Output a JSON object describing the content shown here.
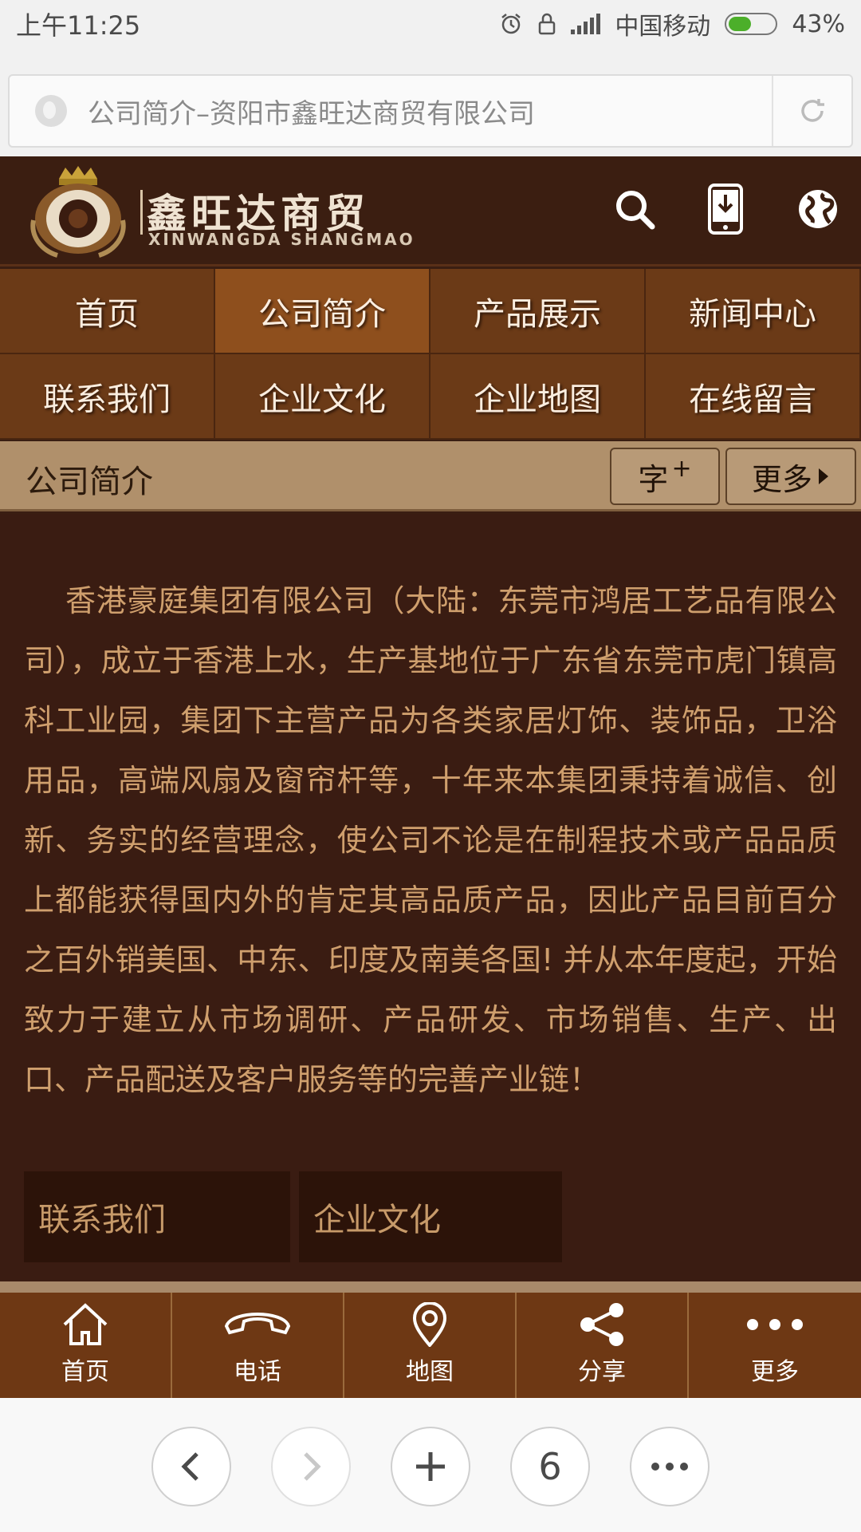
{
  "status": {
    "time": "上午11:25",
    "carrier": "中国移动",
    "battery": "43%"
  },
  "address_bar": {
    "title": "公司简介–资阳市鑫旺达商贸有限公司"
  },
  "site": {
    "logo_cn": "鑫旺达商贸",
    "logo_en": "XINWANGDA SHANGMAO"
  },
  "nav": [
    {
      "label": "首页"
    },
    {
      "label": "公司简介"
    },
    {
      "label": "产品展示"
    },
    {
      "label": "新闻中心"
    },
    {
      "label": "联系我们"
    },
    {
      "label": "企业文化"
    },
    {
      "label": "企业地图"
    },
    {
      "label": "在线留言"
    }
  ],
  "section": {
    "title": "公司简介",
    "font_button": "字",
    "font_button_plus": "+",
    "more_button": "更多"
  },
  "article": {
    "body": "香港豪庭集团有限公司（大陆：东莞市鸿居工艺品有限公司），成立于香港上水，生产基地位于广东省东莞市虎门镇高科工业园，集团下主营产品为各类家居灯饰、装饰品，卫浴用品，高端风扇及窗帘杆等，十年来本集团秉持着诚信、创新、务实的经营理念，使公司不论是在制程技术或产品品质上都能获得国内外的肯定其高品质产品，因此产品目前百分之百外销美国、中东、印度及南美各国! 并从本年度起，开始致力于建立从市场调研、产品研发、市场销售、生产、出口、产品配送及客户服务等的完善产业链！"
  },
  "related": [
    {
      "label": "联系我们"
    },
    {
      "label": "企业文化"
    }
  ],
  "toolbar": [
    {
      "label": "首页",
      "icon": "home-icon"
    },
    {
      "label": "电话",
      "icon": "phone-icon"
    },
    {
      "label": "地图",
      "icon": "map-pin-icon"
    },
    {
      "label": "分享",
      "icon": "share-icon"
    },
    {
      "label": "更多",
      "icon": "more-dots-icon"
    }
  ],
  "browser_nav": {
    "tabs_count": "6"
  },
  "colors": {
    "header_bg": "#3b1e11",
    "nav_bg": "#6b3a17",
    "nav_active": "#8e4f1d",
    "section_bg": "#b0906b",
    "content_bg": "#3a1c12",
    "article_text": "#cf9f6d",
    "toolbar_bg": "#6e3814"
  }
}
